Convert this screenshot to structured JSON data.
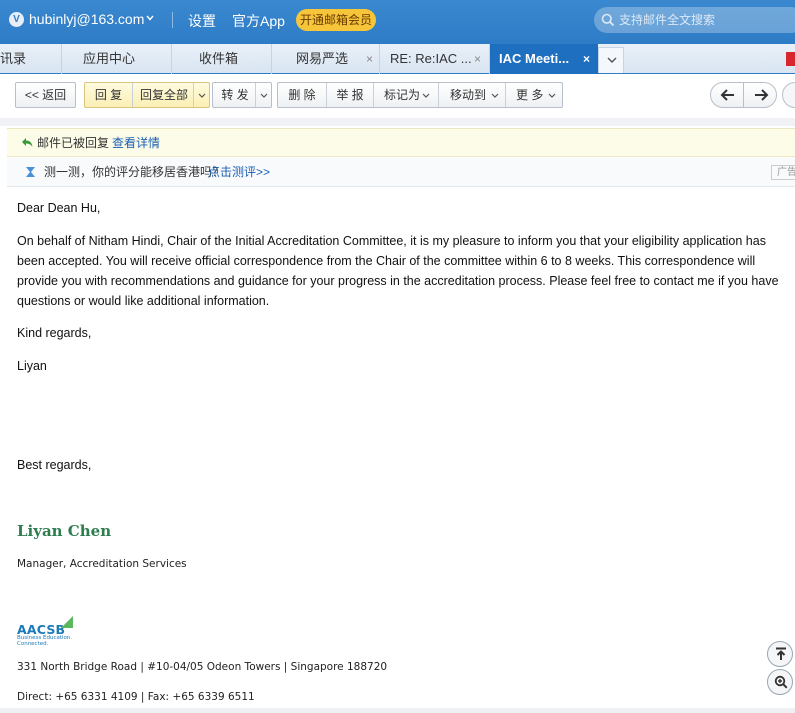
{
  "header": {
    "avatar_letter": "V",
    "account": "hubinlyj@163.com",
    "links": [
      "设置",
      "官方App"
    ],
    "vip_label": "开通邮箱会员",
    "search_placeholder": "支持邮件全文搜索",
    "accent_color": "#2e7cc6"
  },
  "tabs": [
    {
      "label": "讯录",
      "closable": false
    },
    {
      "label": "应用中心",
      "closable": false
    },
    {
      "label": "收件箱",
      "closable": false
    },
    {
      "label": "网易严选",
      "closable": true
    },
    {
      "label": "RE: Re:IAC ...",
      "closable": true
    },
    {
      "label": "IAC Meeti...",
      "closable": true,
      "active": true
    }
  ],
  "toolbar": {
    "back": "<< 返回",
    "reply": "回 复",
    "reply_all": "回复全部",
    "forward": "转 发",
    "delete": "删 除",
    "report": "举 报",
    "mark_as": "标记为",
    "move_to": "移动到",
    "more": "更 多"
  },
  "notice": {
    "text": "邮件已被回复",
    "link": "查看详情"
  },
  "ad": {
    "text": "测一测，你的评分能移居香港吗？",
    "link": "点击测评>>",
    "badge": "广告"
  },
  "email": {
    "greeting": "Dear Dean Hu,",
    "paragraph": "On behalf of Nitham Hindi, Chair of the Initial Accreditation Committee, it is my pleasure to inform you that your eligibility application has been accepted.  You will receive official correspondence from the Chair of the committee within 6 to 8 weeks. This correspondence will provide you with recommendations and guidance for your progress in the accreditation process. Please feel free to contact me if you have questions or would like additional information.",
    "closing1": "Kind regards,",
    "name1": "Liyan",
    "closing2": "Best regards,",
    "signature_name": "Liyan Chen",
    "signature_title": "Manager, Accreditation Services",
    "logo_text": "AACSB",
    "logo_tagline": [
      "Business Education.",
      "Connected."
    ],
    "address": "331 North Bridge Road | #10-04/05 Odeon Towers | Singapore 188720",
    "contact": "Direct: +65 6331 4109 | Fax: +65 6339 6511"
  }
}
